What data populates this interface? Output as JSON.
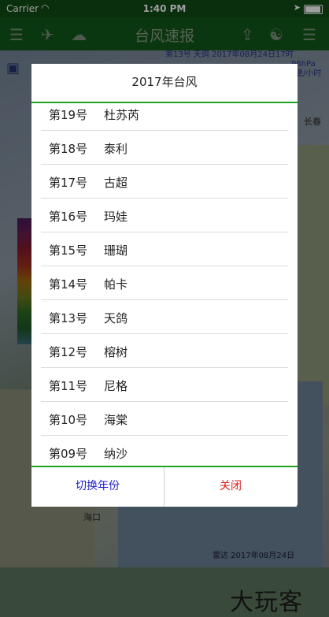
{
  "status_bar": {
    "carrier": "Carrier",
    "time": "1:40 PM"
  },
  "nav": {
    "title": "台风速报"
  },
  "map": {
    "info_line1": "第13号  天鸽  2017年08月24日17时",
    "info_line2": "96hPa",
    "info_line3": "量/小时",
    "label_changchun": "长春",
    "label_haikou": "海口",
    "footer": "雷达 2017年08月24日",
    "watermark": "大玩客"
  },
  "modal": {
    "title": "2017年台风",
    "typhoons": [
      {
        "number": "第19号",
        "name": "杜苏芮"
      },
      {
        "number": "第18号",
        "name": "泰利"
      },
      {
        "number": "第17号",
        "name": "古超"
      },
      {
        "number": "第16号",
        "name": "玛娃"
      },
      {
        "number": "第15号",
        "name": "珊瑚"
      },
      {
        "number": "第14号",
        "name": "帕卡"
      },
      {
        "number": "第13号",
        "name": "天鸽"
      },
      {
        "number": "第12号",
        "name": "榕树"
      },
      {
        "number": "第11号",
        "name": "尼格"
      },
      {
        "number": "第10号",
        "name": "海棠"
      },
      {
        "number": "第09号",
        "name": "纳沙"
      }
    ],
    "switch_year_label": "切换年份",
    "close_label": "关闭"
  },
  "colors": {
    "header_green": "#13591a",
    "accent_green": "#1fa321",
    "switch_blue": "#2323c8",
    "close_red": "#d81e1e"
  }
}
